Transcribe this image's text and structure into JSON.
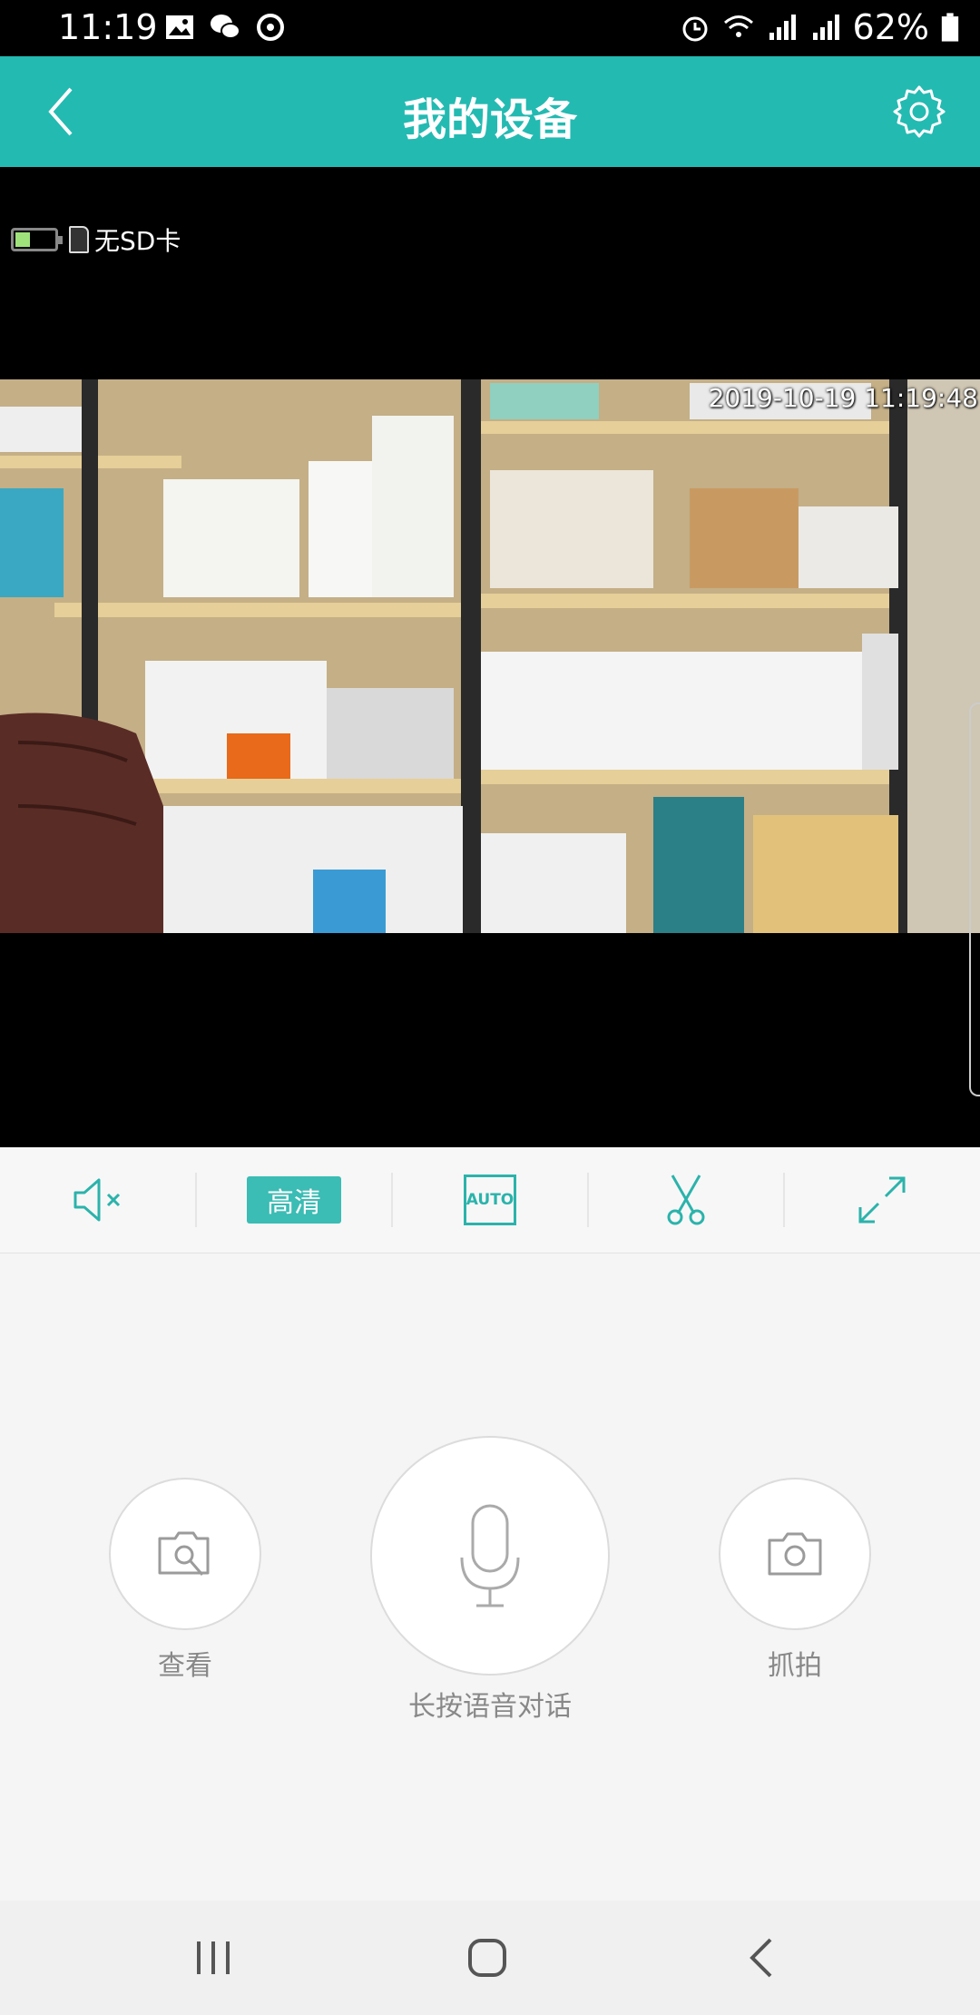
{
  "status_bar": {
    "time": "11:19",
    "battery": "62%",
    "icons_left": [
      "gallery-icon",
      "wechat-icon",
      "sync-icon"
    ],
    "icons_right": [
      "alarm-icon",
      "wifi-icon",
      "signal-icon",
      "signal-icon",
      "battery-icon"
    ]
  },
  "header": {
    "title": "我的设备",
    "back_icon": "chevron-left-icon",
    "settings_icon": "gear-icon"
  },
  "colors": {
    "accent": "#23bab2",
    "accent_button": "#3bbcb4",
    "background": "#f5f5f5"
  },
  "video": {
    "sd_status": "无SD卡",
    "timestamp": "2019-10-19 11:19:48"
  },
  "controls": {
    "mute_icon": "speaker-muted-icon",
    "quality_label": "高清",
    "auto_label": "AUTO",
    "clip_icon": "scissors-icon",
    "fullscreen_icon": "expand-icon"
  },
  "actions": {
    "view_label": "查看",
    "talk_label": "长按语音对话",
    "snapshot_label": "抓拍"
  },
  "nav": {
    "recents_icon": "recents-icon",
    "home_icon": "home-icon",
    "back_icon": "back-icon"
  }
}
